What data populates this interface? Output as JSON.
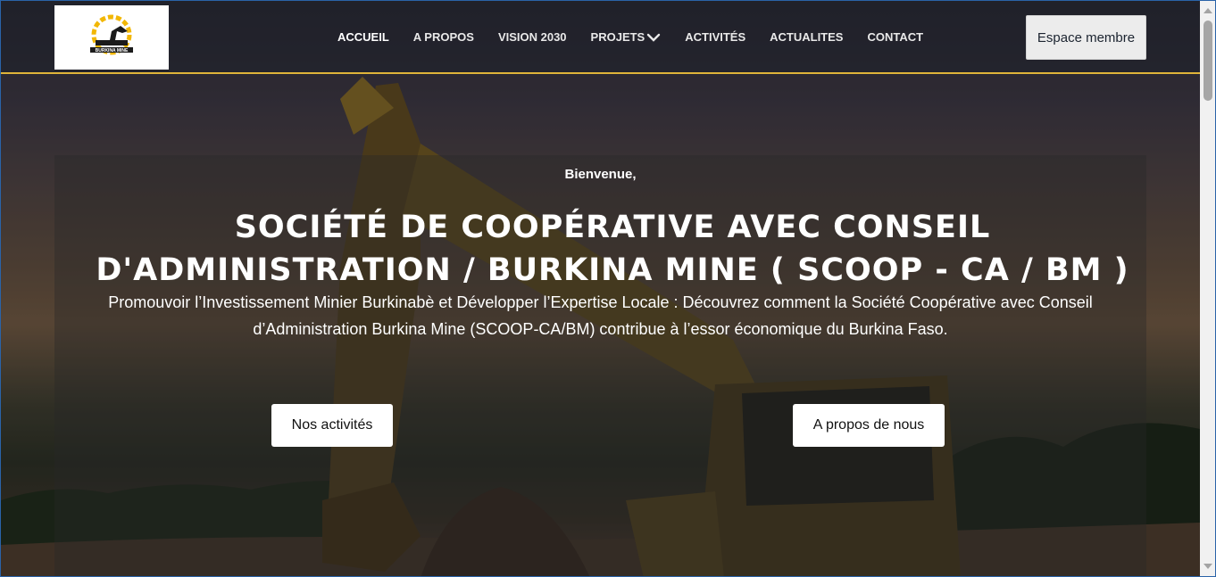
{
  "logo": {
    "text": "BURKINA MINE",
    "accent": "#f2b705"
  },
  "nav": {
    "items": [
      {
        "label": "ACCUEIL",
        "active": true
      },
      {
        "label": "A PROPOS",
        "active": false
      },
      {
        "label": "VISION 2030",
        "active": false
      },
      {
        "label": "PROJETS",
        "active": false,
        "dropdown": true
      },
      {
        "label": "ACTIVITÉS",
        "active": false
      },
      {
        "label": "ACTUALITES",
        "active": false
      },
      {
        "label": "CONTACT",
        "active": false
      }
    ]
  },
  "header": {
    "member_button": "Espace membre",
    "border_color": "#e0b43a"
  },
  "hero": {
    "welcome": "Bienvenue,",
    "title_line1": "SOCIÉTÉ DE COOPÉRATIVE AVEC CONSEIL",
    "title_line2": "D'ADMINISTRATION / BURKINA MINE ( SCOOP - CA / BM )",
    "subtitle_line1": "Promouvoir l’Investissement Minier Burkinabè et Développer l’Expertise Locale : Découvrez comment la Société Coopérative avec Conseil",
    "subtitle_line2": "d’Administration Burkina Mine (SCOOP-CA/BM) contribue à l’essor économique du Burkina Faso.",
    "btn_activities": "Nos activités",
    "btn_about": "A propos de nous"
  }
}
